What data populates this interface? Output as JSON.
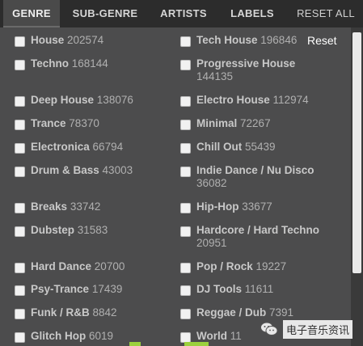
{
  "tabs": {
    "genre": "GENRE",
    "subgenre": "SUB-GENRE",
    "artists": "ARTISTS",
    "labels": "LABELS",
    "reset_all": "RESET ALL"
  },
  "reset_label": "Reset",
  "genres_left": [
    {
      "name": "House",
      "count": "202574"
    },
    {
      "name": "Techno",
      "count": "168144"
    },
    {
      "name": "Deep House",
      "count": "138076"
    },
    {
      "name": "Trance",
      "count": "78370"
    },
    {
      "name": "Electronica",
      "count": "66794"
    },
    {
      "name": "Drum & Bass",
      "count": "43003"
    },
    {
      "name": "Breaks",
      "count": "33742"
    },
    {
      "name": "Dubstep",
      "count": "31583"
    },
    {
      "name": "Hard Dance",
      "count": "20700"
    },
    {
      "name": "Psy-Trance",
      "count": "17439"
    },
    {
      "name": "Funk / R&B",
      "count": "8842"
    },
    {
      "name": "Glitch Hop",
      "count": "6019"
    }
  ],
  "genres_right": [
    {
      "name": "Tech House",
      "count": "196846"
    },
    {
      "name": "Progressive House",
      "count": "144135"
    },
    {
      "name": "Electro House",
      "count": "112974"
    },
    {
      "name": "Minimal",
      "count": "72267"
    },
    {
      "name": "Chill Out",
      "count": "55439"
    },
    {
      "name": "Indie Dance / Nu Disco",
      "count": "36082"
    },
    {
      "name": "Hip-Hop",
      "count": "33677"
    },
    {
      "name": "Hardcore / Hard Techno",
      "count": "20951"
    },
    {
      "name": "Pop / Rock",
      "count": "19227"
    },
    {
      "name": "DJ Tools",
      "count": "11611"
    },
    {
      "name": "Reggae / Dub",
      "count": "7391"
    },
    {
      "name": "World",
      "count": "11"
    }
  ],
  "watermark": {
    "text": "电子音乐资讯"
  },
  "colors": {
    "panel": "#4c4c4d",
    "tabbar": "#2c2c2c",
    "accent_green": "#9bd13d"
  }
}
